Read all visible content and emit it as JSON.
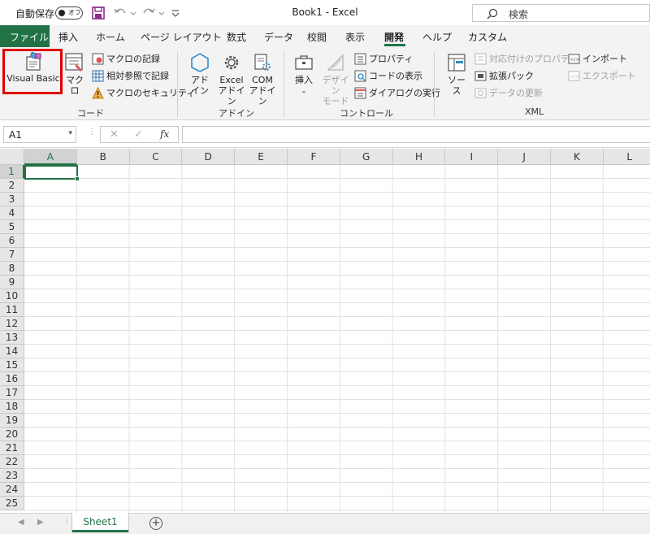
{
  "titlebar": {
    "autosave_label": "自動保存",
    "autosave_toggle": "オフ",
    "doc_title": "Book1  -  Excel",
    "search_placeholder": "検索"
  },
  "tabs": [
    {
      "label": "ファイル"
    },
    {
      "label": "挿入"
    },
    {
      "label": "ホーム"
    },
    {
      "label": "ページ レイアウト"
    },
    {
      "label": "数式"
    },
    {
      "label": "データ"
    },
    {
      "label": "校閲"
    },
    {
      "label": "表示"
    },
    {
      "label": "開発"
    },
    {
      "label": "ヘルプ"
    },
    {
      "label": "カスタム"
    }
  ],
  "ribbon": {
    "code": {
      "label": "コード",
      "visual_basic": "Visual Basic",
      "macro": "マクロ",
      "record_macro": "マクロの記録",
      "relative_ref": "相対参照で記録",
      "macro_security": "マクロのセキュリティ"
    },
    "addins": {
      "label": "アドイン",
      "addin_line1": "アド",
      "addin_line2": "イン",
      "excel_addin_line1": "Excel",
      "excel_addin_line2": "アドイン",
      "com_addin_line1": "COM",
      "com_addin_line2": "アドイン"
    },
    "controls": {
      "label": "コントロール",
      "insert": "挿入",
      "design_line1": "デザイン",
      "design_line2": "モード",
      "properties": "プロパティ",
      "view_code": "コードの表示",
      "run_dialog": "ダイアログの実行"
    },
    "xml": {
      "label": "XML",
      "source": "ソース",
      "map_properties": "対応付けのプロパティ",
      "expansion_packs": "拡張パック",
      "refresh_data": "データの更新",
      "import": "インポート",
      "export": "エクスポート"
    }
  },
  "formula_bar": {
    "name_box": "A1",
    "fx": "fx",
    "cancel": "✕",
    "enter": "✓"
  },
  "grid": {
    "columns": [
      "A",
      "B",
      "C",
      "D",
      "E",
      "F",
      "G",
      "H",
      "I",
      "J",
      "K",
      "L"
    ],
    "rows": [
      "1",
      "2",
      "3",
      "4",
      "5",
      "6",
      "7",
      "8",
      "9",
      "10",
      "11",
      "12",
      "13",
      "14",
      "15",
      "16",
      "17",
      "18",
      "19",
      "20",
      "21",
      "22",
      "23",
      "24",
      "25"
    ],
    "active_cell": "A1"
  },
  "sheets": {
    "tabs": [
      "Sheet1"
    ],
    "add": "+"
  },
  "colors": {
    "accent": "#217346",
    "highlight": "#e00000"
  }
}
